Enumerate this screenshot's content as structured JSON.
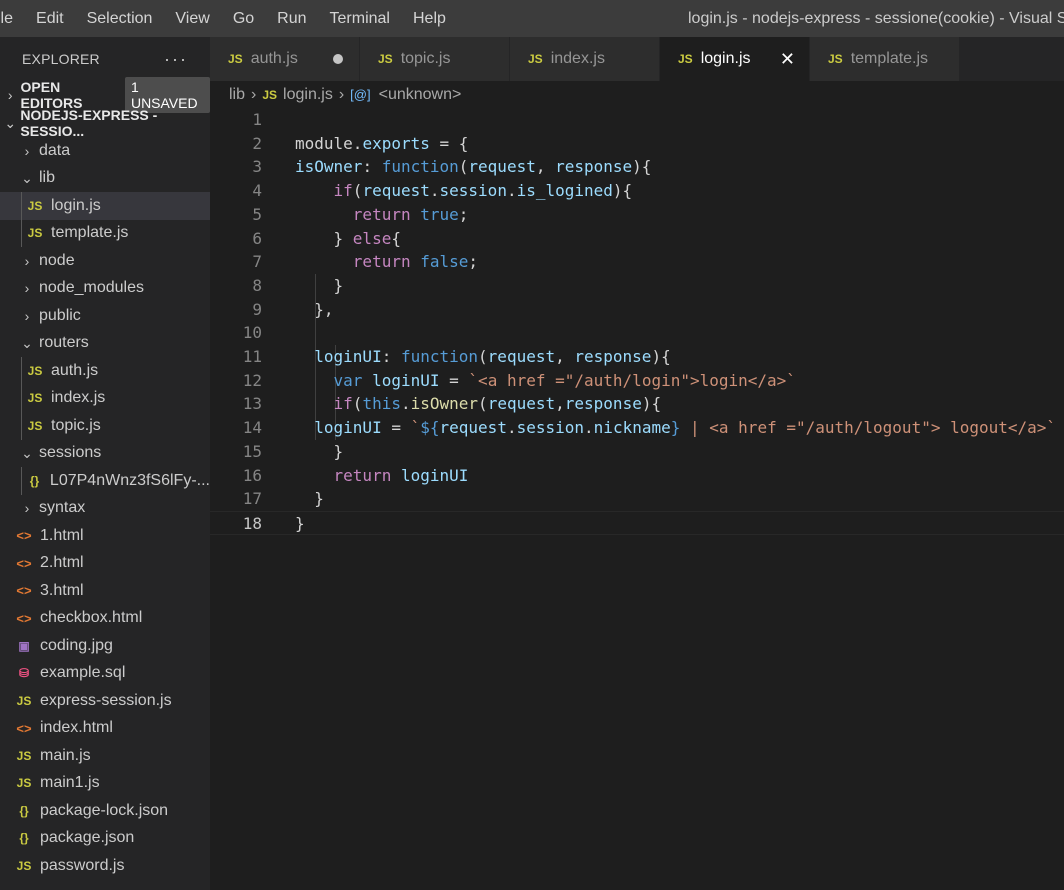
{
  "menu": [
    "ile",
    "Edit",
    "Selection",
    "View",
    "Go",
    "Run",
    "Terminal",
    "Help"
  ],
  "window_title": "login.js - nodejs-express - sessione(cookie) - Visual Studio Code",
  "explorer": {
    "title": "EXPLORER",
    "more": "···",
    "open_editors": "OPEN EDITORS",
    "unsaved_badge": "1 UNSAVED",
    "project": "NODEJS-EXPRESS - SESSIO...",
    "items": [
      {
        "label": "data",
        "kind": "folder",
        "open": false,
        "depth": 1
      },
      {
        "label": "lib",
        "kind": "folder",
        "open": true,
        "depth": 1
      },
      {
        "label": "login.js",
        "kind": "js",
        "depth": 2,
        "selected": true
      },
      {
        "label": "template.js",
        "kind": "js",
        "depth": 2
      },
      {
        "label": "node",
        "kind": "folder",
        "open": false,
        "depth": 1
      },
      {
        "label": "node_modules",
        "kind": "folder",
        "open": false,
        "depth": 1
      },
      {
        "label": "public",
        "kind": "folder",
        "open": false,
        "depth": 1
      },
      {
        "label": "routers",
        "kind": "folder",
        "open": true,
        "depth": 1
      },
      {
        "label": "auth.js",
        "kind": "js",
        "depth": 2
      },
      {
        "label": "index.js",
        "kind": "js",
        "depth": 2
      },
      {
        "label": "topic.js",
        "kind": "js",
        "depth": 2
      },
      {
        "label": "sessions",
        "kind": "folder",
        "open": true,
        "depth": 1
      },
      {
        "label": "L07P4nWnz3fS6lFy-...",
        "kind": "json",
        "depth": 2
      },
      {
        "label": "syntax",
        "kind": "folder",
        "open": false,
        "depth": 1
      },
      {
        "label": "1.html",
        "kind": "html",
        "depth": 1
      },
      {
        "label": "2.html",
        "kind": "html",
        "depth": 1
      },
      {
        "label": "3.html",
        "kind": "html",
        "depth": 1
      },
      {
        "label": "checkbox.html",
        "kind": "html",
        "depth": 1
      },
      {
        "label": "coding.jpg",
        "kind": "img",
        "depth": 1
      },
      {
        "label": "example.sql",
        "kind": "sql",
        "depth": 1
      },
      {
        "label": "express-session.js",
        "kind": "js",
        "depth": 1
      },
      {
        "label": "index.html",
        "kind": "html",
        "depth": 1
      },
      {
        "label": "main.js",
        "kind": "js",
        "depth": 1
      },
      {
        "label": "main1.js",
        "kind": "js",
        "depth": 1
      },
      {
        "label": "package-lock.json",
        "kind": "json",
        "depth": 1
      },
      {
        "label": "package.json",
        "kind": "json",
        "depth": 1
      },
      {
        "label": "password.js",
        "kind": "js",
        "depth": 1
      }
    ]
  },
  "tabs": [
    {
      "label": "auth.js",
      "state": "unsaved"
    },
    {
      "label": "topic.js",
      "state": ""
    },
    {
      "label": "index.js",
      "state": ""
    },
    {
      "label": "login.js",
      "state": "active"
    },
    {
      "label": "template.js",
      "state": ""
    }
  ],
  "icons": {
    "js": "JS",
    "html": "<>",
    "json": "{}",
    "img": "image-icon",
    "sql": "database-icon",
    "chevron_right": "chevron-right-icon",
    "chevron_down": "chevron-down-icon"
  },
  "breadcrumb": {
    "folder": "lib",
    "file": "login.js",
    "symbol": "<unknown>"
  },
  "code_lines": [
    {
      "n": "1",
      "tokens": []
    },
    {
      "n": "2",
      "tokens": [
        [
          "t",
          "module"
        ],
        [
          "t",
          "."
        ],
        [
          "v",
          "exports"
        ],
        [
          "t",
          " = "
        ],
        [
          "t",
          "{"
        ]
      ]
    },
    {
      "n": "3",
      "tokens": [
        [
          "v",
          "isOwner"
        ],
        [
          "t",
          ": "
        ],
        [
          "k",
          "function"
        ],
        [
          "t",
          "("
        ],
        [
          "v",
          "request"
        ],
        [
          "t",
          ", "
        ],
        [
          "v",
          "response"
        ],
        [
          "t",
          "){"
        ]
      ]
    },
    {
      "n": "4",
      "tokens": [
        [
          "t",
          "    "
        ],
        [
          "c",
          "if"
        ],
        [
          "t",
          "("
        ],
        [
          "v",
          "request"
        ],
        [
          "t",
          "."
        ],
        [
          "v",
          "session"
        ],
        [
          "t",
          "."
        ],
        [
          "v",
          "is_logined"
        ],
        [
          "t",
          "){"
        ]
      ]
    },
    {
      "n": "5",
      "tokens": [
        [
          "t",
          "      "
        ],
        [
          "c",
          "return"
        ],
        [
          "t",
          " "
        ],
        [
          "k",
          "true"
        ],
        [
          "t",
          ";"
        ]
      ]
    },
    {
      "n": "6",
      "tokens": [
        [
          "t",
          "    } "
        ],
        [
          "c",
          "else"
        ],
        [
          "t",
          "{"
        ]
      ]
    },
    {
      "n": "7",
      "tokens": [
        [
          "t",
          "      "
        ],
        [
          "c",
          "return"
        ],
        [
          "t",
          " "
        ],
        [
          "k",
          "false"
        ],
        [
          "t",
          ";"
        ]
      ]
    },
    {
      "n": "8",
      "tokens": [
        [
          "t",
          "    }"
        ]
      ]
    },
    {
      "n": "9",
      "tokens": [
        [
          "t",
          "  },"
        ]
      ]
    },
    {
      "n": "10",
      "tokens": []
    },
    {
      "n": "11",
      "tokens": [
        [
          "t",
          "  "
        ],
        [
          "v",
          "loginUI"
        ],
        [
          "t",
          ": "
        ],
        [
          "k",
          "function"
        ],
        [
          "t",
          "("
        ],
        [
          "v",
          "request"
        ],
        [
          "t",
          ", "
        ],
        [
          "v",
          "response"
        ],
        [
          "t",
          "){"
        ]
      ]
    },
    {
      "n": "12",
      "tokens": [
        [
          "t",
          "    "
        ],
        [
          "k",
          "var"
        ],
        [
          "t",
          " "
        ],
        [
          "v",
          "loginUI"
        ],
        [
          "t",
          " = "
        ],
        [
          "s",
          "`<a href =\"/auth/login\">login</a>`"
        ]
      ]
    },
    {
      "n": "13",
      "tokens": [
        [
          "t",
          "    "
        ],
        [
          "c",
          "if"
        ],
        [
          "t",
          "("
        ],
        [
          "k",
          "this"
        ],
        [
          "t",
          "."
        ],
        [
          "f",
          "isOwner"
        ],
        [
          "t",
          "("
        ],
        [
          "v",
          "request"
        ],
        [
          "t",
          ","
        ],
        [
          "v",
          "response"
        ],
        [
          "t",
          "){"
        ]
      ]
    },
    {
      "n": "14",
      "tokens": [
        [
          "t",
          "  "
        ],
        [
          "v",
          "loginUI"
        ],
        [
          "t",
          " = "
        ],
        [
          "s",
          "`"
        ],
        [
          "k",
          "${"
        ],
        [
          "v",
          "request"
        ],
        [
          "t",
          "."
        ],
        [
          "v",
          "session"
        ],
        [
          "t",
          "."
        ],
        [
          "v",
          "nickname"
        ],
        [
          "k",
          "}"
        ],
        [
          "s",
          " | <a href =\"/auth/logout\"> logout</a>`"
        ]
      ]
    },
    {
      "n": "15",
      "tokens": [
        [
          "t",
          "    }"
        ]
      ]
    },
    {
      "n": "16",
      "tokens": [
        [
          "t",
          "    "
        ],
        [
          "c",
          "return"
        ],
        [
          "t",
          " "
        ],
        [
          "v",
          "loginUI"
        ]
      ]
    },
    {
      "n": "17",
      "tokens": [
        [
          "t",
          "  }"
        ]
      ]
    },
    {
      "n": "18",
      "tokens": [
        [
          "t",
          "}"
        ]
      ]
    }
  ]
}
